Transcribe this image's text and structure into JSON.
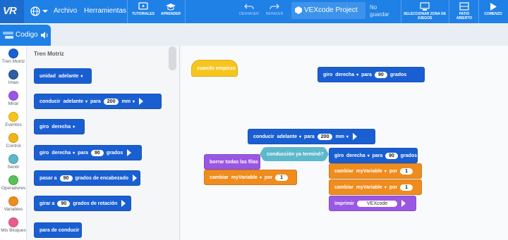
{
  "app": {
    "logo": "VR",
    "menu": [
      "Archivo",
      "Herramientas"
    ],
    "toolbar": {
      "tutorials": "TUTORIALES",
      "learn": "APRENDER",
      "undo": "DESHACER",
      "redo": "REHACER",
      "select_playground": "SELECCIONAR ZONA DE JUEGOS",
      "playground": "PATIO ABIERTO",
      "start": "COMENZO"
    },
    "project_name": "VEXcode Project",
    "save_status": "No guardar"
  },
  "code_tab": {
    "label": "Codigo"
  },
  "categories": [
    {
      "label": "Tren Motriz",
      "color": "#1a5fd1"
    },
    {
      "label": "Iman",
      "color": "#2e5f9e"
    },
    {
      "label": "Mirar",
      "color": "#9a57e3"
    },
    {
      "label": "Eventos",
      "color": "#f7c51e"
    },
    {
      "label": "Control",
      "color": "#f0b41a"
    },
    {
      "label": "Sentir",
      "color": "#5cb8cb"
    },
    {
      "label": "Operadores",
      "color": "#59c059"
    },
    {
      "label": "Variables",
      "color": "#ef8c1e"
    },
    {
      "label": "Mis Bloques",
      "color": "#ea5d8a"
    }
  ],
  "flyout": {
    "title": "Tren Motriz",
    "blocks": [
      {
        "p1": "unidad",
        "d1": "adelante"
      },
      {
        "p1": "conducir",
        "d1": "adelante",
        "p2": "para",
        "n1": "200",
        "d2": "mm"
      },
      {
        "p1": "giro",
        "d1": "derecha"
      },
      {
        "p1": "giro",
        "d1": "derecha",
        "p2": "para",
        "n1": "90",
        "p3": "grados"
      },
      {
        "p1": "pasar a",
        "n1": "90",
        "p3": "grados de encabezado"
      },
      {
        "p1": "girar a",
        "n1": "90",
        "p3": "grados de rotación"
      },
      {
        "p1": "para de conducir"
      }
    ]
  },
  "workspace": {
    "when_started": "cuando empiezo",
    "turn_top": {
      "p1": "giro",
      "d1": "derecha",
      "p2": "para",
      "n1": "90",
      "p3": "grados"
    },
    "drive_block": {
      "p1": "conducir",
      "d1": "adelante",
      "p2": "para",
      "n1": "200",
      "d2": "mm"
    },
    "drive_done": "conducción ya terminó?",
    "clear_rows": "borrar todas las filas",
    "change_var_left": {
      "p1": "cambiar",
      "d1": "myVariable",
      "p2": "por",
      "n1": "1"
    },
    "turn_right": {
      "p1": "giro",
      "d1": "derecha",
      "p2": "para",
      "n1": "90",
      "p3": "grados"
    },
    "change_var_1": {
      "p1": "cambiar",
      "d1": "myVariable",
      "p2": "por",
      "n1": "1"
    },
    "change_var_2": {
      "p1": "cambiar",
      "d1": "myVariable",
      "p2": "por",
      "n1": "1"
    },
    "print_block": {
      "p1": "imprimir",
      "s1": "VEXcode"
    }
  }
}
